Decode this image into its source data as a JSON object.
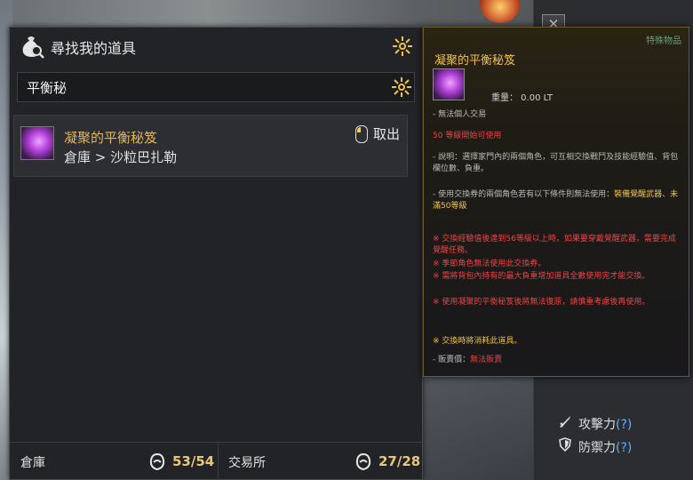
{
  "window": {
    "title": "尋找我的道具",
    "search_value": "平衡秘",
    "result": {
      "name": "凝聚的平衡秘笈",
      "location": "倉庫 > 沙粒巴扎勒",
      "action_label": "取出"
    },
    "footer": {
      "storage_label": "倉庫",
      "storage_count": "53/54",
      "trade_label": "交易所",
      "trade_count": "27/28"
    }
  },
  "tooltip": {
    "category": "特殊物品",
    "title": "凝聚的平衡秘笈",
    "weight": "重量：  0.00 LT",
    "no_trade": "- 無法個人交易",
    "level_req": "50 等級開始可使用",
    "desc": "- 說明：選擇家門內的兩個角色，可互相交換戰鬥及技能經驗值、背包欄位數、負重。",
    "restriction_prefix": "- 使用交換券的兩個角色若有以下條件則無法使用：",
    "restriction_items": "裝備覺醒武器、未滿50等級",
    "warn1": "※ 交換經驗值後達到56等級以上時，如果要穿戴覺醒武器，需要完成覺醒任務。",
    "warn2": "※ 季節角色無法使用此交換券。",
    "warn3": "※ 需將背包內持有的最大負重增加道具全數使用完才能交換。",
    "warn4": "※ 使用凝聚的平衡秘笈後將無法復原，請慎重考慮後再使用。",
    "consume_note": "※ 交換時將消耗此道具。",
    "sell_label": "- 販賣價：",
    "sell_value": "無法販賣"
  },
  "side_panel": {
    "attack_label": "攻擊力",
    "defense_label": "防禦力",
    "help": "(?)"
  },
  "colors": {
    "accent_gold": "#e3b55b",
    "warning_red": "#e74545",
    "panel_bg": "#222326"
  }
}
